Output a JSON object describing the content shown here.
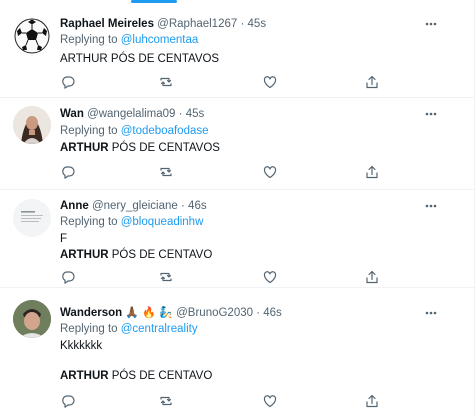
{
  "colors": {
    "accent": "#1d9bf0",
    "secondary_text": "#536471",
    "divider": "#eff3f4"
  },
  "tweets": [
    {
      "name": "Raphael Meireles",
      "handle": "@Raphael1267",
      "separator": "·",
      "time": "45s",
      "reply_prefix": "Replying to ",
      "reply_to": "@luhcomentaa",
      "text_line1": "ARTHUR PÓS DE CENTAVOS",
      "avatar": "soccer-ball"
    },
    {
      "name": "Wan",
      "handle": "@wangelalima09",
      "separator": "·",
      "time": "45s",
      "reply_prefix": "Replying to ",
      "reply_to": "@todeboafodase",
      "text_bold": "ARTHUR",
      "text_rest": " PÓS DE CENTAVOS",
      "avatar": "person-photo"
    },
    {
      "name": "Anne",
      "handle": "@nery_gleiciane",
      "separator": "·",
      "time": "46s",
      "reply_prefix": "Replying to ",
      "reply_to": "@bloqueadinhw",
      "text_line1": "F",
      "text_bold": "ARTHUR",
      "text_rest": " PÓS DE CENTAVO",
      "avatar": "text-card"
    },
    {
      "name": "Wanderson",
      "name_emojis": [
        "🙏🏾",
        "🔥",
        "🧞"
      ],
      "handle": "@BrunoG2030",
      "separator": "·",
      "time": "46s",
      "reply_prefix": "Replying to ",
      "reply_to": "@centralreality",
      "text_line1": "Kkkkkkk",
      "text_bold": "ARTHUR",
      "text_rest": " PÓS DE CENTAVO",
      "avatar": "person-photo"
    }
  ],
  "icons": {
    "more": "more-dots-icon",
    "reply": "reply-icon",
    "retweet": "retweet-icon",
    "like": "like-icon",
    "share": "share-icon"
  }
}
